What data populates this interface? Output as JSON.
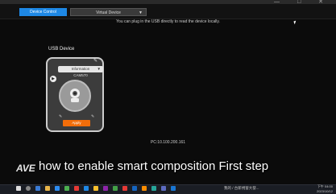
{
  "window": {
    "controls": "— □ ✕"
  },
  "tabs": [
    {
      "label": "Device Control"
    },
    {
      "label": "Virtual Device"
    }
  ],
  "info_text": "You can plug in the USB directly to read the device locally.",
  "usb_section": {
    "label": "USB Device",
    "card": {
      "dropdown_label": "Information",
      "device_name": "CAM570",
      "apply_label": "Apply"
    }
  },
  "pc_address": "PC:10.100.200.161",
  "overlay": {
    "logo": "AVE",
    "caption": "how to enable smart composition First step"
  },
  "taskbar": {
    "tray_text": "我的 / 台新視窗大發...",
    "time": "下午 04:00",
    "date": "2023/10/12"
  },
  "colors": {
    "accent": "#1e88e5",
    "apply": "#f26d0a"
  }
}
